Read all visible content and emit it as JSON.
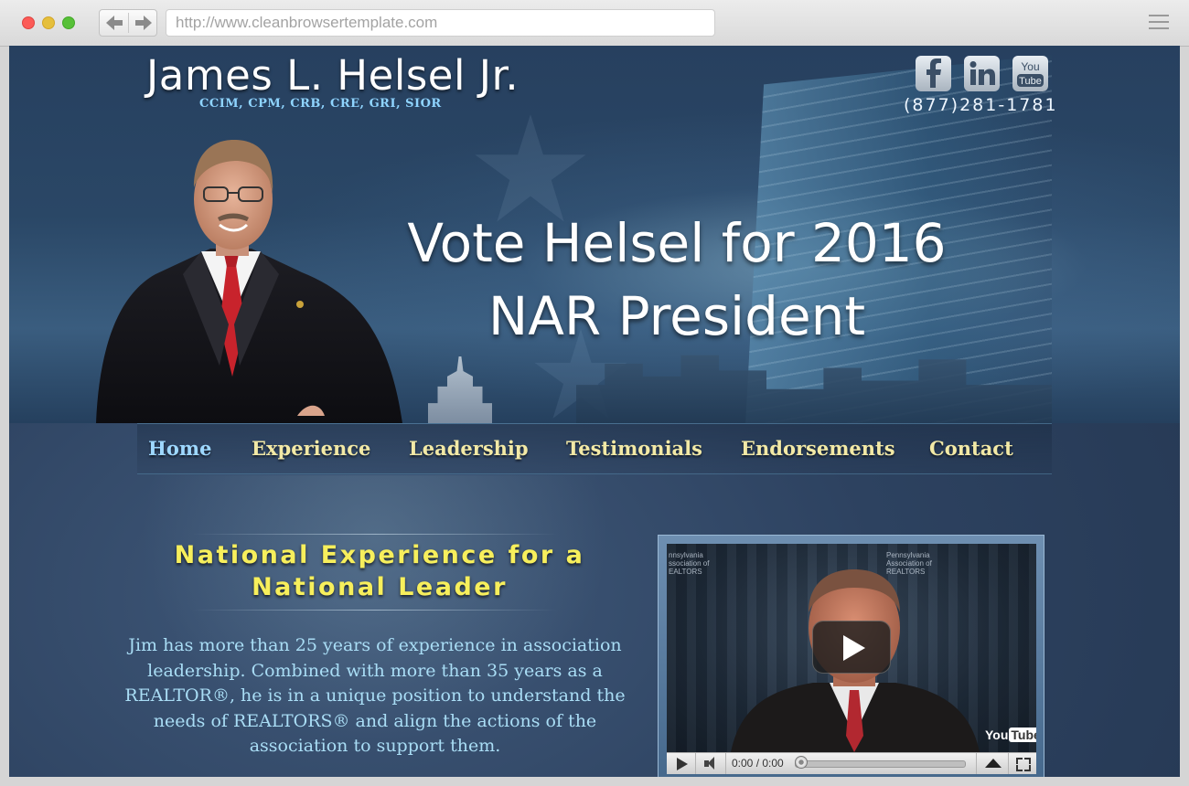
{
  "browser": {
    "url": "http://www.cleanbrowsertemplate.com"
  },
  "header": {
    "name": "James L. Helsel Jr.",
    "credentials": "CCIM, CPM, CRB, CRE, GRI, SIOR",
    "phone": "(877)281-1781",
    "social": [
      "facebook-icon",
      "linkedin-icon",
      "youtube-icon"
    ]
  },
  "hero": {
    "headline_line1": "Vote Helsel for 2016",
    "headline_line2": "NAR President"
  },
  "nav": {
    "items": [
      {
        "label": "Home",
        "active": true
      },
      {
        "label": "Experience"
      },
      {
        "label": "Leadership"
      },
      {
        "label": "Testimonials"
      },
      {
        "label": "Endorsements"
      },
      {
        "label": "Contact"
      }
    ]
  },
  "content": {
    "title_line1": "National Experience for a",
    "title_line2": "National Leader",
    "body": "Jim has more than 25 years of experience in association leadership. Combined with more than 35 years as a REALTOR®, he is in a unique position to understand the needs of REALTORS® and align the actions of the association to support them."
  },
  "video": {
    "time": "0:00 / 0:00",
    "youtube_you": "You",
    "youtube_tube": "Tube",
    "logo_left": "nnsylvania\nssociation of\nEALTORS",
    "logo_right": "Pennsylvania\nAssociation of\nREALTORS"
  },
  "colors": {
    "nav_text": "#f2e9a6",
    "nav_active": "#9ed8ff",
    "section_title": "#f7ef5c",
    "body_text": "#a9ddf5",
    "page_bg": "#2d4260"
  }
}
